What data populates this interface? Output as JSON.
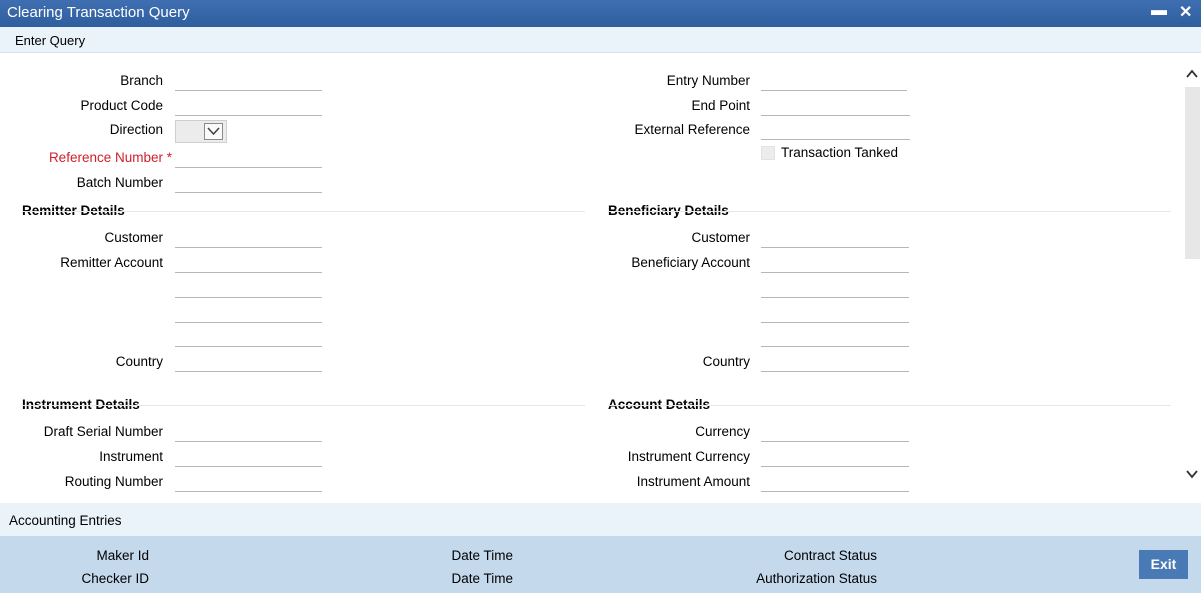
{
  "window": {
    "title": "Clearing Transaction Query",
    "minimize_glyph": "▬",
    "close_glyph": "✕"
  },
  "toolbar": {
    "enter_query": "Enter Query"
  },
  "main": {
    "branch": {
      "label": "Branch",
      "value": ""
    },
    "product_code": {
      "label": "Product Code",
      "value": ""
    },
    "direction": {
      "label": "Direction",
      "value": ""
    },
    "reference_number": {
      "label": "Reference Number *",
      "value": ""
    },
    "batch_number": {
      "label": "Batch Number",
      "value": ""
    },
    "entry_number": {
      "label": "Entry Number",
      "value": ""
    },
    "end_point": {
      "label": "End Point",
      "value": ""
    },
    "external_reference": {
      "label": "External Reference",
      "value": ""
    },
    "transaction_tanked": {
      "label": "Transaction Tanked",
      "checked": false
    }
  },
  "remitter": {
    "title": "Remitter Details",
    "customer_label": "Customer",
    "account_label": "Remitter Account",
    "country_label": "Country"
  },
  "beneficiary": {
    "title": "Beneficiary Details",
    "customer_label": "Customer",
    "account_label": "Beneficiary Account",
    "country_label": "Country"
  },
  "instrument": {
    "title": "Instrument Details",
    "draft_serial_label": "Draft Serial Number",
    "instrument_label": "Instrument",
    "routing_label": "Routing Number"
  },
  "account": {
    "title": "Account Details",
    "currency_label": "Currency",
    "instrument_currency_label": "Instrument Currency",
    "instrument_amount_label": "Instrument Amount"
  },
  "accounting": {
    "label": "Accounting Entries"
  },
  "footer": {
    "maker_id": "Maker Id",
    "checker_id": "Checker ID",
    "date_time_1": "Date Time",
    "date_time_2": "Date Time",
    "contract_status": "Contract Status",
    "authorization_status": "Authorization Status",
    "exit": "Exit"
  },
  "colors": {
    "titlebar": "#2e5e9e",
    "required": "#d0202a",
    "footer": "#c5d9ec",
    "exit_button": "#4a7ab5"
  },
  "icons": {
    "minimize": "minimize-icon",
    "close": "close-icon",
    "dropdown": "chevron-down-icon",
    "scroll_up": "chevron-up-icon",
    "scroll_down": "chevron-down-icon"
  }
}
